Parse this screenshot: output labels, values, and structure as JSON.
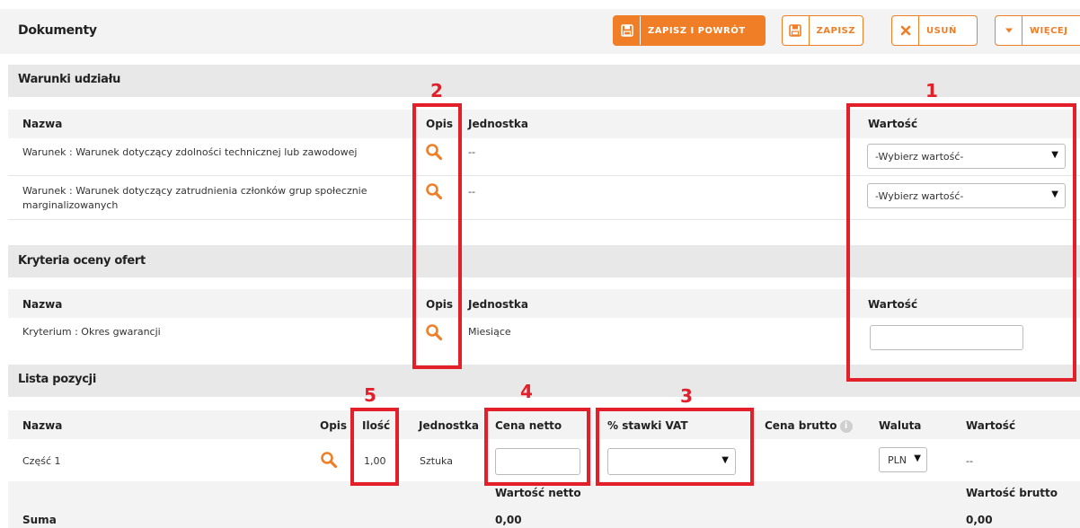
{
  "header": {
    "title": "Dokumenty",
    "buttons": {
      "save_return": "ZAPISZ I POWRÓT",
      "save": "ZAPISZ",
      "delete": "USUŃ",
      "more": "WIĘCEJ"
    }
  },
  "conditions": {
    "title": "Warunki udziału",
    "headers": {
      "name": "Nazwa",
      "desc": "Opis",
      "unit": "Jednostka",
      "value": "Wartość"
    },
    "rows": [
      {
        "name": "Warunek :  Warunek dotyczący zdolności technicznej lub zawodowej",
        "unit": "--",
        "value": "-Wybierz wartość-"
      },
      {
        "name_line1": "Warunek :  Warunek dotyczący zatrudnienia członków grup społecznie",
        "name_line2": "marginalizowanych",
        "unit": "--",
        "value": "-Wybierz wartość-"
      }
    ]
  },
  "criteria": {
    "title": "Kryteria oceny ofert",
    "headers": {
      "name": "Nazwa",
      "desc": "Opis",
      "unit": "Jednostka",
      "value": "Wartość"
    },
    "rows": [
      {
        "name": "Kryterium :  Okres gwarancji",
        "unit": "Miesiące",
        "value": ""
      }
    ]
  },
  "positions": {
    "title": "Lista pozycji",
    "headers": {
      "name": "Nazwa",
      "desc": "Opis",
      "qty": "Ilość",
      "unit": "Jednostka",
      "net_price": "Cena netto",
      "vat": "% stawki VAT",
      "gross_price": "Cena brutto",
      "currency": "Waluta",
      "value": "Wartość"
    },
    "rows": [
      {
        "name": "Część 1",
        "qty": "1,00",
        "unit": "Sztuka",
        "net_price": "",
        "vat": "",
        "currency": "PLN",
        "value": "--"
      }
    ],
    "summary": {
      "net_label": "Wartość netto",
      "gross_label": "Wartość brutto",
      "sum_label": "Suma",
      "net_value": "0,00",
      "gross_value": "0,00"
    }
  },
  "annotations": [
    "1",
    "2",
    "3",
    "4",
    "5"
  ],
  "colors": {
    "accent": "#f07e26",
    "annotation": "#e3202a"
  }
}
